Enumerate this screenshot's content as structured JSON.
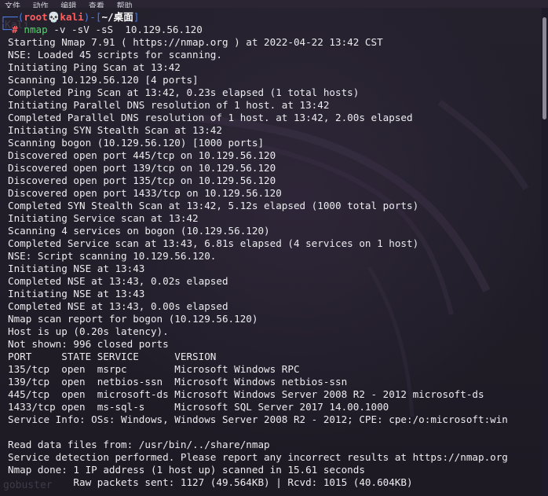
{
  "menubar": {
    "items": [
      "文件",
      "动作",
      "编辑",
      "查看",
      "帮助"
    ]
  },
  "watermarks": {
    "top": "Kali",
    "bottom": "gobuster"
  },
  "prompt": {
    "user": "root",
    "skull": "💀",
    "host": "kali",
    "path": "~/桌面",
    "prefix": "┌──(",
    "mid": ")-[",
    "suffix": "]",
    "corner": "└─",
    "hash": "#",
    "command": "nmap",
    "args": " -v -sV -sS  10.129.56.120"
  },
  "output_lines": [
    "Starting Nmap 7.91 ( https://nmap.org ) at 2022-04-22 13:42 CST",
    "NSE: Loaded 45 scripts for scanning.",
    "Initiating Ping Scan at 13:42",
    "Scanning 10.129.56.120 [4 ports]",
    "Completed Ping Scan at 13:42, 0.23s elapsed (1 total hosts)",
    "Initiating Parallel DNS resolution of 1 host. at 13:42",
    "Completed Parallel DNS resolution of 1 host. at 13:42, 2.00s elapsed",
    "Initiating SYN Stealth Scan at 13:42",
    "Scanning bogon (10.129.56.120) [1000 ports]",
    "Discovered open port 445/tcp on 10.129.56.120",
    "Discovered open port 139/tcp on 10.129.56.120",
    "Discovered open port 135/tcp on 10.129.56.120",
    "Discovered open port 1433/tcp on 10.129.56.120",
    "Completed SYN Stealth Scan at 13:42, 5.12s elapsed (1000 total ports)",
    "Initiating Service scan at 13:42",
    "Scanning 4 services on bogon (10.129.56.120)",
    "Completed Service scan at 13:43, 6.81s elapsed (4 services on 1 host)",
    "NSE: Script scanning 10.129.56.120.",
    "Initiating NSE at 13:43",
    "Completed NSE at 13:43, 0.02s elapsed",
    "Initiating NSE at 13:43",
    "Completed NSE at 13:43, 0.00s elapsed",
    "Nmap scan report for bogon (10.129.56.120)",
    "Host is up (0.20s latency).",
    "Not shown: 996 closed ports",
    "PORT     STATE SERVICE      VERSION",
    "135/tcp  open  msrpc        Microsoft Windows RPC",
    "139/tcp  open  netbios-ssn  Microsoft Windows netbios-ssn",
    "445/tcp  open  microsoft-ds Microsoft Windows Server 2008 R2 - 2012 microsoft-ds",
    "1433/tcp open  ms-sql-s     Microsoft SQL Server 2017 14.00.1000",
    "Service Info: OSs: Windows, Windows Server 2008 R2 - 2012; CPE: cpe:/o:microsoft:win",
    "",
    "Read data files from: /usr/bin/../share/nmap",
    "Service detection performed. Please report any incorrect results at https://nmap.org",
    "Nmap done: 1 IP address (1 host up) scanned in 15.61 seconds",
    "           Raw packets sent: 1127 (49.564KB) | Rcvd: 1015 (40.604KB)"
  ],
  "colors": {
    "background": "#1f1a29",
    "prompt_frame": "#4d7fe6",
    "prompt_user": "#ff5e5e",
    "command": "#54d16e",
    "text": "#ececef"
  }
}
